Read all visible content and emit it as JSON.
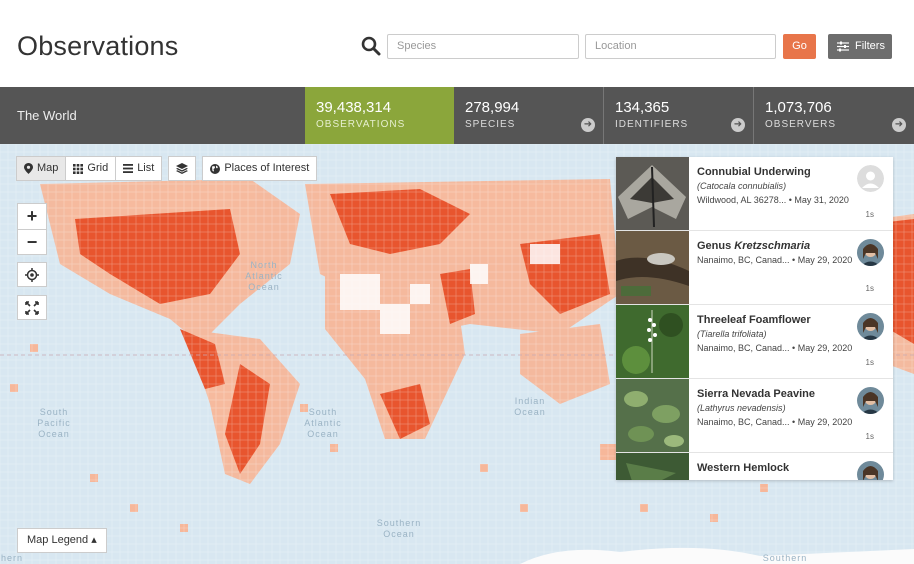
{
  "header": {
    "title": "Observations",
    "species_placeholder": "Species",
    "location_placeholder": "Location",
    "go_label": "Go",
    "filters_label": "Filters"
  },
  "stats": {
    "place": "The World",
    "observations": {
      "value": "39,438,314",
      "label": "OBSERVATIONS"
    },
    "species": {
      "value": "278,994",
      "label": "SPECIES"
    },
    "identifiers": {
      "value": "134,365",
      "label": "IDENTIFIERS"
    },
    "observers": {
      "value": "1,073,706",
      "label": "OBSERVERS"
    }
  },
  "map_toolbar": {
    "map": "Map",
    "grid": "Grid",
    "list": "List",
    "places": "Places of Interest"
  },
  "map": {
    "zoom_in": "+",
    "zoom_out": "−",
    "legend": "Map Legend ▴",
    "labels": {
      "north_atlantic": "North Atlantic Ocean",
      "south_pacific": "South Pacific Ocean",
      "south_atlantic": "South Atlantic Ocean",
      "indian": "Indian Ocean",
      "southern": "Southern Ocean",
      "southern2": "Southern",
      "hern": "hern"
    }
  },
  "observations": [
    {
      "common": "Connubial Underwing",
      "scientific": "Catocala connubialis",
      "place": "Wildwood, AL 36278...",
      "date": "May 31, 2020",
      "age": "1s"
    },
    {
      "common_prefix": "Genus ",
      "common": "Kretzschmaria",
      "scientific": "",
      "place": "Nanaimo, BC, Canad...",
      "date": "May 29, 2020",
      "age": "1s"
    },
    {
      "common": "Threeleaf Foamflower",
      "scientific": "Tiarella trifoliata",
      "place": "Nanaimo, BC, Canad...",
      "date": "May 29, 2020",
      "age": "1s"
    },
    {
      "common": "Sierra Nevada Peavine",
      "scientific": "Lathyrus nevadensis",
      "place": "Nanaimo, BC, Canad...",
      "date": "May 29, 2020",
      "age": "1s"
    },
    {
      "common": "Western Hemlock",
      "scientific": "",
      "place": "",
      "date": "",
      "age": ""
    }
  ],
  "colors": {
    "accent_green": "#8ba63b",
    "go_orange": "#e8754a",
    "stats_bg": "#555555",
    "heat_dense": "#e8552e",
    "heat_light": "#f6b79a",
    "ocean": "#d8e7f1"
  }
}
